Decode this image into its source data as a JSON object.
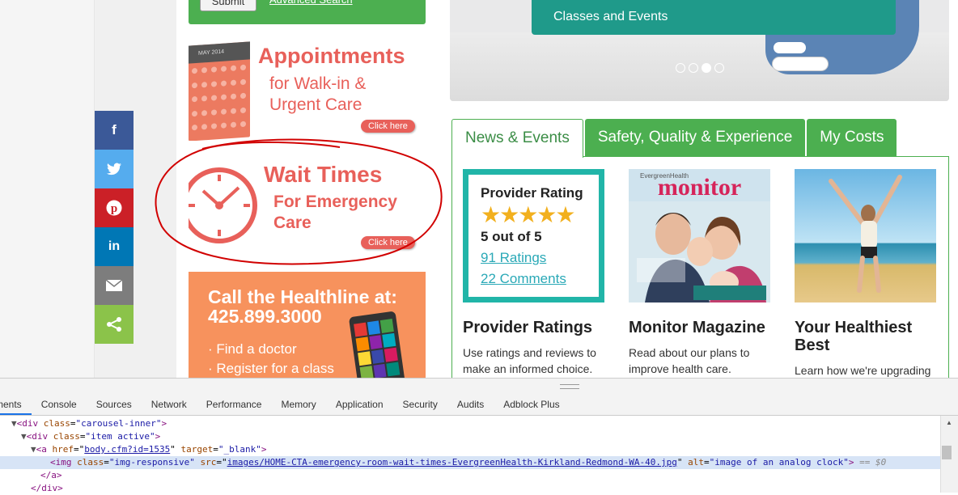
{
  "search": {
    "submit_label": "Submit",
    "advanced_label": "Advanced Search"
  },
  "cta": {
    "appointments": {
      "title_1": "Appointments",
      "title_2": "for Walk-in &",
      "title_3": "Urgent Care",
      "button": "Click here",
      "calendar_month": "MAY 2014"
    },
    "wait_times": {
      "title_1": "Wait Times",
      "title_2": "For Emergency",
      "title_3": "Care",
      "button": "Click here"
    },
    "healthline": {
      "line_1": "Call the Healthline at:",
      "line_2": "425.899.3000",
      "bullet_1": "· Find a doctor",
      "bullet_2": "· Register for a class"
    }
  },
  "share": [
    {
      "name": "facebook",
      "glyph": "f",
      "color": "#3b5998"
    },
    {
      "name": "twitter",
      "glyph": "t",
      "color": "#55acee"
    },
    {
      "name": "pinterest",
      "glyph": "p",
      "color": "#cb2027"
    },
    {
      "name": "linkedin",
      "glyph": "in",
      "color": "#0077b5"
    },
    {
      "name": "email",
      "glyph": "✉",
      "color": "#7d7d7d"
    },
    {
      "name": "share",
      "glyph": "share",
      "color": "#8bc34a"
    }
  ],
  "hero": {
    "caption": "Classes and Events",
    "active_slide": 3,
    "slide_count": 4
  },
  "tabs": [
    {
      "label": "News & Events",
      "active": true
    },
    {
      "label": "Safety, Quality & Experience",
      "active": false
    },
    {
      "label": "My Costs",
      "active": false
    }
  ],
  "cards": {
    "ratings": {
      "box_title": "Provider Rating",
      "stars": "★★★★★",
      "score": "5 out of 5",
      "ratings_link": "91 Ratings",
      "comments_link": "22 Comments",
      "title": "Provider Ratings",
      "text": "Use ratings and reviews to make an informed choice."
    },
    "monitor": {
      "brand": "EvergreenHealth",
      "masthead": "monitor",
      "title": "Monitor Magazine",
      "text": "Read about our plans to improve health care."
    },
    "healthiest": {
      "title": "Your Healthiest Best",
      "text": "Learn how we're upgrading"
    }
  },
  "devtools": {
    "tabs": [
      "ments",
      "Console",
      "Sources",
      "Network",
      "Performance",
      "Memory",
      "Application",
      "Security",
      "Audits",
      "Adblock Plus"
    ],
    "code": {
      "l1_tag": "<div",
      "l1_attr": "class",
      "l1_val": "\"carousel-inner\"",
      "l2_tag": "<div",
      "l2_attr": "class",
      "l2_val": "\"item active\"",
      "l3_tag": "<a",
      "l3_attr1": "href",
      "l3_val1": "body.cfm?id=1535",
      "l3_attr2": "target",
      "l3_val2": "\"_blank\"",
      "l4_tag": "<img",
      "l4_attr1": "class",
      "l4_val1": "\"img-responsive\"",
      "l4_attr2": "src",
      "l4_val2": "images/HOME-CTA-emergency-room-wait-times-EvergreenHealth-Kirkland-Redmond-WA-40.jpg",
      "l4_attr3": "alt",
      "l4_val3": "\"image of an analog clock\"",
      "l4_eq": "== $0",
      "l5": "</a>",
      "l6": "</div>"
    }
  }
}
